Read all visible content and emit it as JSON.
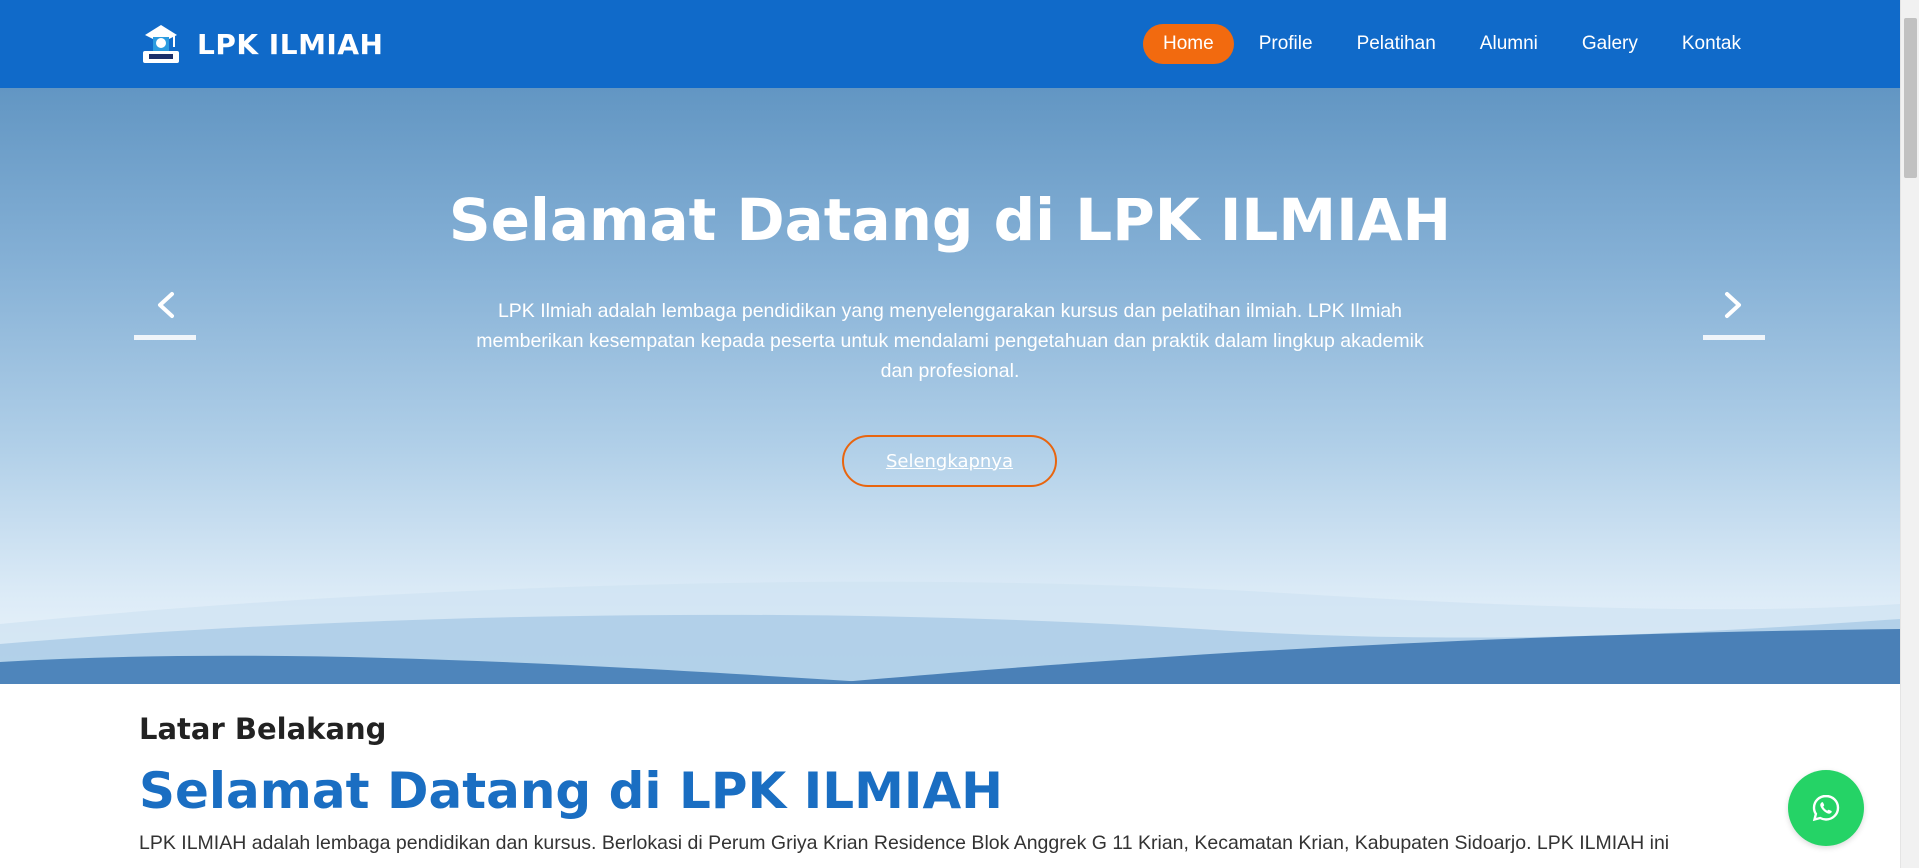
{
  "header": {
    "brand": "LPK ILMIAH",
    "nav": [
      {
        "label": "Home",
        "active": true
      },
      {
        "label": "Profile",
        "active": false
      },
      {
        "label": "Pelatihan",
        "active": false
      },
      {
        "label": "Alumni",
        "active": false
      },
      {
        "label": "Galery",
        "active": false
      },
      {
        "label": "Kontak",
        "active": false
      }
    ]
  },
  "hero": {
    "title": "Selamat Datang di LPK ILMIAH",
    "text": "LPK Ilmiah adalah lembaga pendidikan yang menyelenggarakan kursus dan pelatihan ilmiah. LPK Ilmiah memberikan kesempatan kepada peserta untuk mendalami pengetahuan dan praktik dalam lingkup akademik dan profesional.",
    "button": "Selengkapnya",
    "prev_icon": "chevron-left-icon",
    "next_icon": "chevron-right-icon"
  },
  "content": {
    "subtitle": "Latar Belakang",
    "title": "Selamat Datang di LPK ILMIAH",
    "text": "LPK ILMIAH adalah lembaga pendidikan dan kursus. Berlokasi di Perum Griya Krian Residence Blok Anggrek G 11 Krian, Kecamatan Krian, Kabupaten Sidoarjo. LPK ILMIAH ini"
  },
  "whatsapp_icon": "whatsapp-icon",
  "colors": {
    "header": "#106ac9",
    "accent": "#f26a0f",
    "title_blue": "#1a6ec2",
    "whatsapp": "#25d366"
  }
}
